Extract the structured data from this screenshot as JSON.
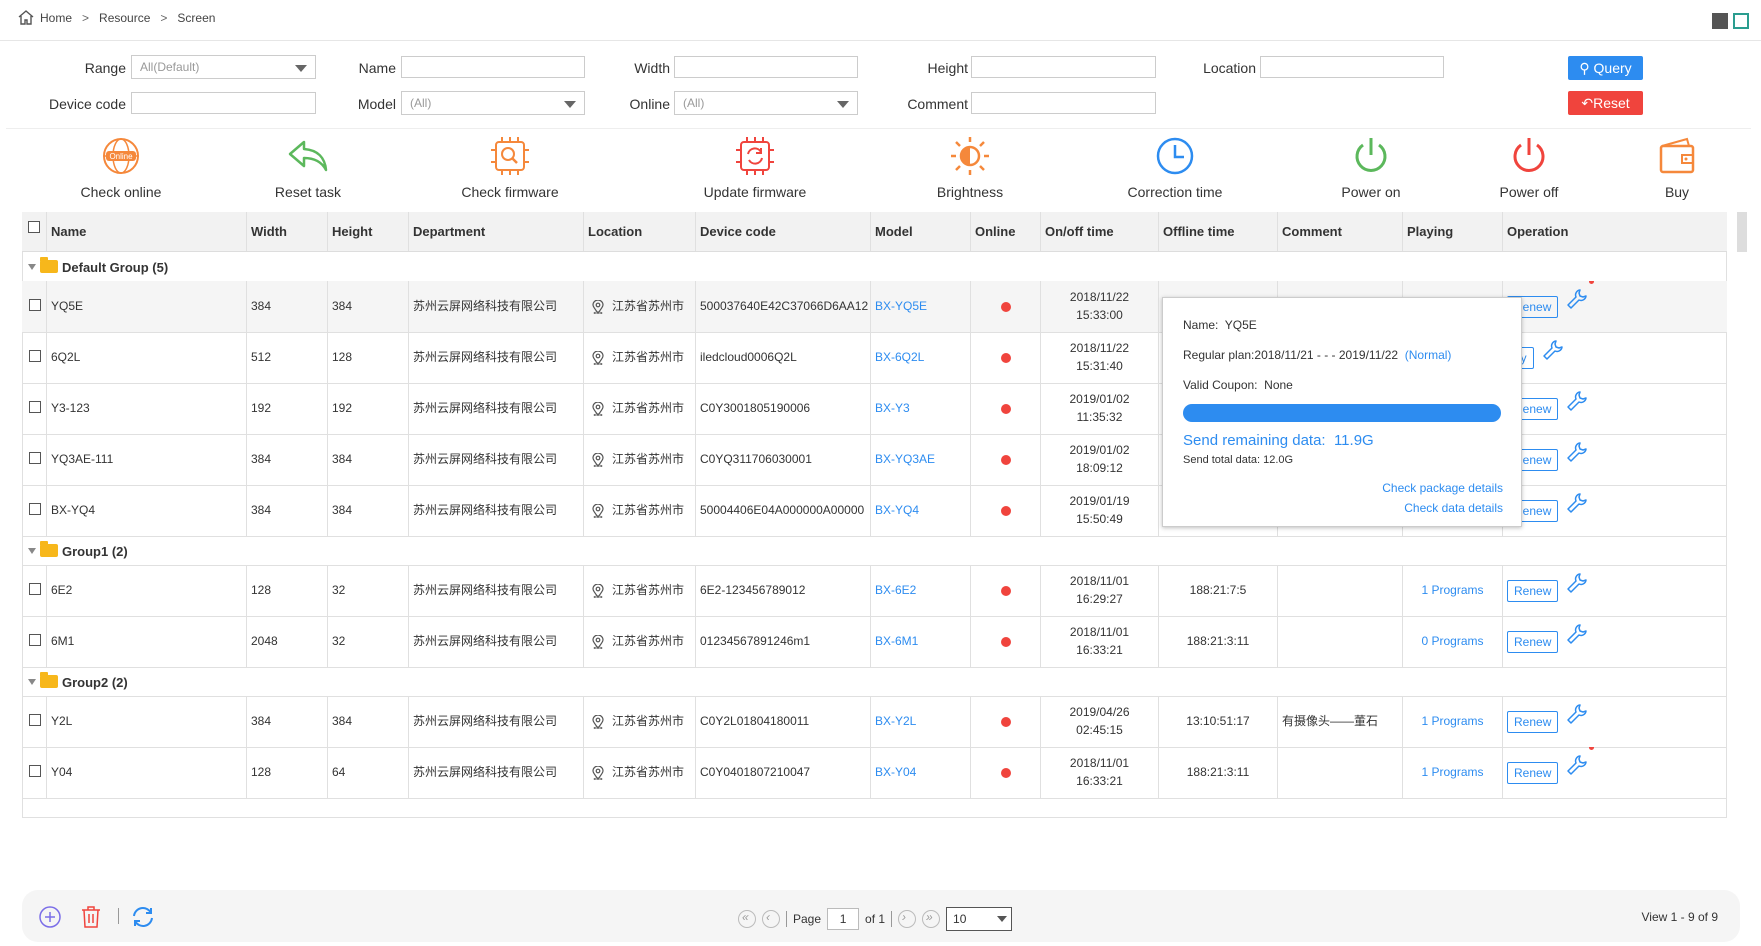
{
  "breadcrumb": {
    "home": "Home",
    "resource": "Resource",
    "screen": "Screen",
    "sep": ">"
  },
  "filters": {
    "range_label": "Range",
    "range_value": "All(Default)",
    "name_label": "Name",
    "name_value": "",
    "width_label": "Width",
    "width_value": "",
    "height_label": "Height",
    "height_value": "",
    "location_label": "Location",
    "location_value": "",
    "device_code_label": "Device code",
    "device_code_value": "",
    "model_label": "Model",
    "model_value": "(All)",
    "online_label": "Online",
    "online_value": "(All)",
    "comment_label": "Comment",
    "comment_value": "",
    "query_label": "Query",
    "reset_label": "Reset"
  },
  "toolbar": [
    {
      "label": "Check online",
      "icon": "globe-online-icon"
    },
    {
      "label": "Reset task",
      "icon": "undo-arrow-icon"
    },
    {
      "label": "Check firmware",
      "icon": "chip-search-icon"
    },
    {
      "label": "Update firmware",
      "icon": "chip-refresh-icon"
    },
    {
      "label": "Brightness",
      "icon": "sun-icon"
    },
    {
      "label": "Correction time",
      "icon": "clock-icon"
    },
    {
      "label": "Power on",
      "icon": "power-green-icon"
    },
    {
      "label": "Power off",
      "icon": "power-red-icon"
    },
    {
      "label": "Buy",
      "icon": "wallet-icon"
    }
  ],
  "table": {
    "headers": [
      "Name",
      "Width",
      "Height",
      "Department",
      "Location",
      "Device code",
      "Model",
      "Online",
      "On/off time",
      "Offline time",
      "Comment",
      "Playing",
      "Operation"
    ],
    "groups": [
      {
        "label": "Default Group (5)",
        "rows": [
          {
            "name": "YQ5E",
            "width": "384",
            "height": "384",
            "department": "苏州云屏网络科技有限公司",
            "location": "江苏省苏州市",
            "device_code": "500037640E42C37066D6AA12",
            "model": "BX-YQ5E",
            "onoff_date": "2018/11/22",
            "onoff_time": "15:33:00",
            "offline": "",
            "comment": "",
            "playing": "",
            "renew": "Renew"
          },
          {
            "name": "6Q2L",
            "width": "512",
            "height": "128",
            "department": "苏州云屏网络科技有限公司",
            "location": "江苏省苏州市",
            "device_code": "iledcloud0006Q2L",
            "model": "BX-6Q2L",
            "onoff_date": "2018/11/22",
            "onoff_time": "15:31:40",
            "offline": "",
            "comment": "",
            "playing": "",
            "renew": "uy"
          },
          {
            "name": "Y3-123",
            "width": "192",
            "height": "192",
            "department": "苏州云屏网络科技有限公司",
            "location": "江苏省苏州市",
            "device_code": "C0Y3001805190006",
            "model": "BX-Y3",
            "onoff_date": "2019/01/02",
            "onoff_time": "11:35:32",
            "offline": "",
            "comment": "",
            "playing": "",
            "renew": "Renew"
          },
          {
            "name": "YQ3AE-111",
            "width": "384",
            "height": "384",
            "department": "苏州云屏网络科技有限公司",
            "location": "江苏省苏州市",
            "device_code": "C0YQ311706030001",
            "model": "BX-YQ3AE",
            "onoff_date": "2019/01/02",
            "onoff_time": "18:09:12",
            "offline": "",
            "comment": "",
            "playing": "",
            "renew": "Renew"
          },
          {
            "name": "BX-YQ4",
            "width": "384",
            "height": "384",
            "department": "苏州云屏网络科技有限公司",
            "location": "江苏省苏州市",
            "device_code": "50004406E04A000000A00000",
            "model": "BX-YQ4",
            "onoff_date": "2019/01/19",
            "onoff_time": "15:50:49",
            "offline": "",
            "comment": "",
            "playing": "",
            "renew": "Renew"
          }
        ]
      },
      {
        "label": "Group1 (2)",
        "rows": [
          {
            "name": "6E2",
            "width": "128",
            "height": "32",
            "department": "苏州云屏网络科技有限公司",
            "location": "江苏省苏州市",
            "device_code": "6E2-123456789012",
            "model": "BX-6E2",
            "onoff_date": "2018/11/01",
            "onoff_time": "16:29:27",
            "offline": "188:21:7:5",
            "comment": "",
            "playing": "1 Programs",
            "renew": "Renew"
          },
          {
            "name": "6M1",
            "width": "2048",
            "height": "32",
            "department": "苏州云屏网络科技有限公司",
            "location": "江苏省苏州市",
            "device_code": "01234567891246m1",
            "model": "BX-6M1",
            "onoff_date": "2018/11/01",
            "onoff_time": "16:33:21",
            "offline": "188:21:3:11",
            "comment": "",
            "playing": "0 Programs",
            "renew": "Renew"
          }
        ]
      },
      {
        "label": "Group2 (2)",
        "rows": [
          {
            "name": "Y2L",
            "width": "384",
            "height": "384",
            "department": "苏州云屏网络科技有限公司",
            "location": "江苏省苏州市",
            "device_code": "C0Y2L01804180011",
            "model": "BX-Y2L",
            "onoff_date": "2019/04/26",
            "onoff_time": "02:45:15",
            "offline": "13:10:51:17",
            "comment": "有摄像头——董石",
            "playing": "1 Programs",
            "renew": "Renew"
          },
          {
            "name": "Y04",
            "width": "128",
            "height": "64",
            "department": "苏州云屏网络科技有限公司",
            "location": "江苏省苏州市",
            "device_code": "C0Y0401807210047",
            "model": "BX-Y04",
            "onoff_date": "2018/11/01",
            "onoff_time": "16:33:21",
            "offline": "188:21:3:11",
            "comment": "",
            "playing": "1 Programs",
            "renew": "Renew"
          }
        ]
      }
    ]
  },
  "popup": {
    "name_label": "Name:",
    "name_value": "YQ5E",
    "plan_label": "Regular plan:",
    "plan_value": "2018/11/21 - - - 2019/11/22",
    "plan_status": "(Normal)",
    "coupon_label": "Valid Coupon:",
    "coupon_value": "None",
    "remaining_label": "Send remaining data:",
    "remaining_value": "11.9G",
    "total_label": "Send total data:",
    "total_value": "12.0G",
    "remaining_fraction": 1.0,
    "package_link": "Check package details",
    "data_link": "Check data details"
  },
  "pager": {
    "page_label": "Page",
    "page_value": "1",
    "of_label": "of 1",
    "page_size": "10",
    "view_text": "View 1 - 9 of 9"
  },
  "colors": {
    "accent": "#2d8cf0",
    "danger": "#f0443d",
    "orange": "#f5883b",
    "green": "#5cb85c",
    "folder": "#f7b71b"
  }
}
